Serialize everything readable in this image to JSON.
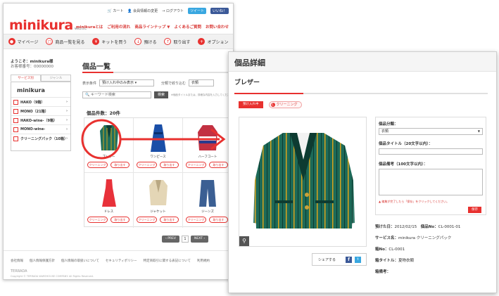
{
  "colors": {
    "brand_red": "#e8312f",
    "twitter_blue": "#39a7e0",
    "facebook_blue": "#3b5998"
  },
  "back": {
    "logo": "minikura",
    "logo_version": "ver2.0.C",
    "topnav": {
      "cart": "カート",
      "account": "会員情報の変更",
      "logout": "ログアウト",
      "tweet": "ツイート",
      "like": "いいね！"
    },
    "mainnav": [
      "minikuraとは",
      "ご利用の流れ",
      "商品ラインナップ ▼",
      "よくあるご質問",
      "お問い合わせ"
    ],
    "subnav": [
      "マイページ",
      "商品一覧を見る",
      "キットを買う",
      "預ける",
      "取り出す",
      "オプション"
    ],
    "welcome": "ようこそ：minikura様",
    "member_no": "お客様番号：00000000",
    "side_tabs": [
      "サービス別",
      "ジャンル"
    ],
    "side_brand": "minikura",
    "side_items": [
      "HAKO（9箱）",
      "MONO（21箱）",
      "HAKO-wine-（9箱）",
      "MONO-wine-",
      "クリーニングパック（10箱）"
    ],
    "list_title": "個品一覧",
    "filter_label": "表示条件",
    "filter_value": "預け入れ中のみ表示",
    "sort_label": "分類で絞り込む",
    "sort_value": "衣類",
    "search_placeholder": "キーワード検索",
    "search_button": "検索",
    "search_note": "※個品タイトルまたは、詳細な内容を入力してください",
    "count": "個品件数：20件",
    "products": [
      {
        "name": "ブレザー",
        "btn1": "クリーニング",
        "btn2": "取り出す"
      },
      {
        "name": "ワンピース",
        "btn1": "クリーニング",
        "btn2": "取り出す"
      },
      {
        "name": "ハーフコート",
        "btn1": "クリーニング",
        "btn2": "取り出す"
      },
      {
        "name": "ドレス",
        "btn1": "クリーニング",
        "btn2": "取り出す"
      },
      {
        "name": "ジャケット",
        "btn1": "クリーニング",
        "btn2": "取り出す"
      },
      {
        "name": "ジーンズ",
        "btn1": "クリーニング",
        "btn2": "取り出す"
      }
    ],
    "pager": {
      "prev": "‹ PREV",
      "page": "1",
      "next": "NEXT ›"
    },
    "footer_links": [
      "会社情報",
      "個人情報保護方針",
      "個人情報の取扱いについて",
      "セキュリティポリシー",
      "特定商取引に関する表記について",
      "利用規約"
    ],
    "footer_logo": "TERRADA",
    "copyright": "Copyright © TERRADA WAREHOUSE COMPANY. All Rights Reserved."
  },
  "front": {
    "header": "個品詳細",
    "item_title": "ブレザー",
    "status_tag": "預け入れ中",
    "cleaning_tag": "クリーニング",
    "cleaning_tag_icon": "C",
    "form": {
      "category_label": "個品分類：",
      "category_value": "衣類",
      "title_label": "個品タイトル（20文字以内）：",
      "memo_label": "個品備考（100文字以内）：",
      "note": "▲ 編集が完了したら「保存」をクリックしてください。",
      "save": "保存"
    },
    "share_label": "シェアする",
    "share_fb": "f",
    "share_tw": "t",
    "info": {
      "deposit_label": "預けた日：",
      "deposit_value": "2012/02/15",
      "item_no_label": "個品No：",
      "item_no_value": "CL-0001-01",
      "service_label": "サービス名：",
      "service_value": "minikura クリーニングパック",
      "box_no_label": "箱No：",
      "box_no_value": "CL-0001",
      "box_title_label": "箱タイトル：",
      "box_title_value": "夏物衣類",
      "box_memo_label": "箱備考："
    }
  }
}
